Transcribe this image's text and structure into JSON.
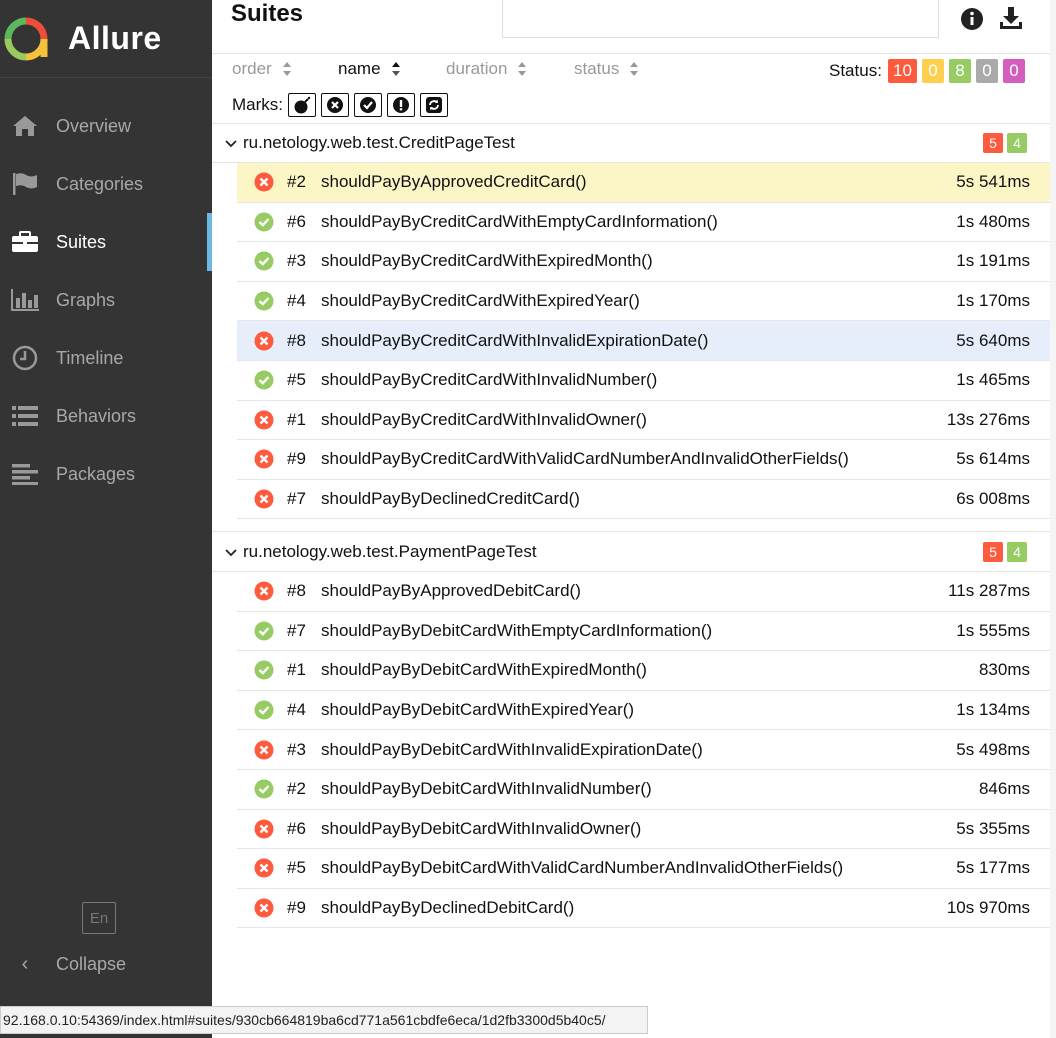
{
  "app": {
    "name": "Allure"
  },
  "sidebar": {
    "items": [
      {
        "label": "Overview",
        "icon": "home-icon"
      },
      {
        "label": "Categories",
        "icon": "flag-icon"
      },
      {
        "label": "Suites",
        "icon": "briefcase-icon",
        "active": true
      },
      {
        "label": "Graphs",
        "icon": "bar-chart-icon"
      },
      {
        "label": "Timeline",
        "icon": "clock-icon"
      },
      {
        "label": "Behaviors",
        "icon": "list-icon"
      },
      {
        "label": "Packages",
        "icon": "align-left-icon"
      }
    ],
    "language": "En",
    "collapse_label": "Collapse"
  },
  "header": {
    "title": "Suites"
  },
  "controls": {
    "sorters": [
      "order",
      "name",
      "duration",
      "status"
    ],
    "status_label": "Status:",
    "status_counts": [
      {
        "value": "10",
        "color": "#fd5a3e"
      },
      {
        "value": "0",
        "color": "#ffd050"
      },
      {
        "value": "8",
        "color": "#97cc64"
      },
      {
        "value": "0",
        "color": "#aaaaaa"
      },
      {
        "value": "0",
        "color": "#d35ebe"
      }
    ],
    "marks_label": "Marks:",
    "marks": [
      "flaky-bomb-icon",
      "new-failed-icon",
      "new-passed-icon",
      "new-broken-icon",
      "retries-icon"
    ]
  },
  "suites": [
    {
      "name": "ru.netology.web.test.CreditPageTest",
      "failed": "5",
      "passed": "4",
      "tests": [
        {
          "status": "failed",
          "num": "#2",
          "name": "shouldPayByApprovedCreditCard()",
          "duration": "5s 541ms"
        },
        {
          "status": "passed",
          "num": "#6",
          "name": "shouldPayByCreditCardWithEmptyCardInformation()",
          "duration": "1s 480ms"
        },
        {
          "status": "passed",
          "num": "#3",
          "name": "shouldPayByCreditCardWithExpiredMonth()",
          "duration": "1s 191ms"
        },
        {
          "status": "passed",
          "num": "#4",
          "name": "shouldPayByCreditCardWithExpiredYear()",
          "duration": "1s 170ms"
        },
        {
          "status": "failed",
          "num": "#8",
          "name": "shouldPayByCreditCardWithInvalidExpirationDate()",
          "duration": "5s 640ms"
        },
        {
          "status": "passed",
          "num": "#5",
          "name": "shouldPayByCreditCardWithInvalidNumber()",
          "duration": "1s 465ms"
        },
        {
          "status": "failed",
          "num": "#1",
          "name": "shouldPayByCreditCardWithInvalidOwner()",
          "duration": "13s 276ms"
        },
        {
          "status": "failed",
          "num": "#9",
          "name": "shouldPayByCreditCardWithValidCardNumberAndInvalidOtherFields()",
          "duration": "5s 614ms"
        },
        {
          "status": "failed",
          "num": "#7",
          "name": "shouldPayByDeclinedCreditCard()",
          "duration": "6s 008ms"
        }
      ]
    },
    {
      "name": "ru.netology.web.test.PaymentPageTest",
      "failed": "5",
      "passed": "4",
      "tests": [
        {
          "status": "failed",
          "num": "#8",
          "name": "shouldPayByApprovedDebitCard()",
          "duration": "11s 287ms"
        },
        {
          "status": "passed",
          "num": "#7",
          "name": "shouldPayByDebitCardWithEmptyCardInformation()",
          "duration": "1s 555ms"
        },
        {
          "status": "passed",
          "num": "#1",
          "name": "shouldPayByDebitCardWithExpiredMonth()",
          "duration": "830ms"
        },
        {
          "status": "passed",
          "num": "#4",
          "name": "shouldPayByDebitCardWithExpiredYear()",
          "duration": "1s 134ms"
        },
        {
          "status": "failed",
          "num": "#3",
          "name": "shouldPayByDebitCardWithInvalidExpirationDate()",
          "duration": "5s 498ms"
        },
        {
          "status": "passed",
          "num": "#2",
          "name": "shouldPayByDebitCardWithInvalidNumber()",
          "duration": "846ms"
        },
        {
          "status": "failed",
          "num": "#6",
          "name": "shouldPayByDebitCardWithInvalidOwner()",
          "duration": "5s 355ms"
        },
        {
          "status": "failed",
          "num": "#5",
          "name": "shouldPayByDebitCardWithValidCardNumberAndInvalidOtherFields()",
          "duration": "5s 177ms"
        },
        {
          "status": "failed",
          "num": "#9",
          "name": "shouldPayByDeclinedDebitCard()",
          "duration": "10s 970ms"
        }
      ]
    }
  ],
  "status_bar": {
    "url": "92.168.0.10:54369/index.html#suites/930cb664819ba6cd771a561cbdfe6eca/1d2fb3300d5b40c5/"
  }
}
